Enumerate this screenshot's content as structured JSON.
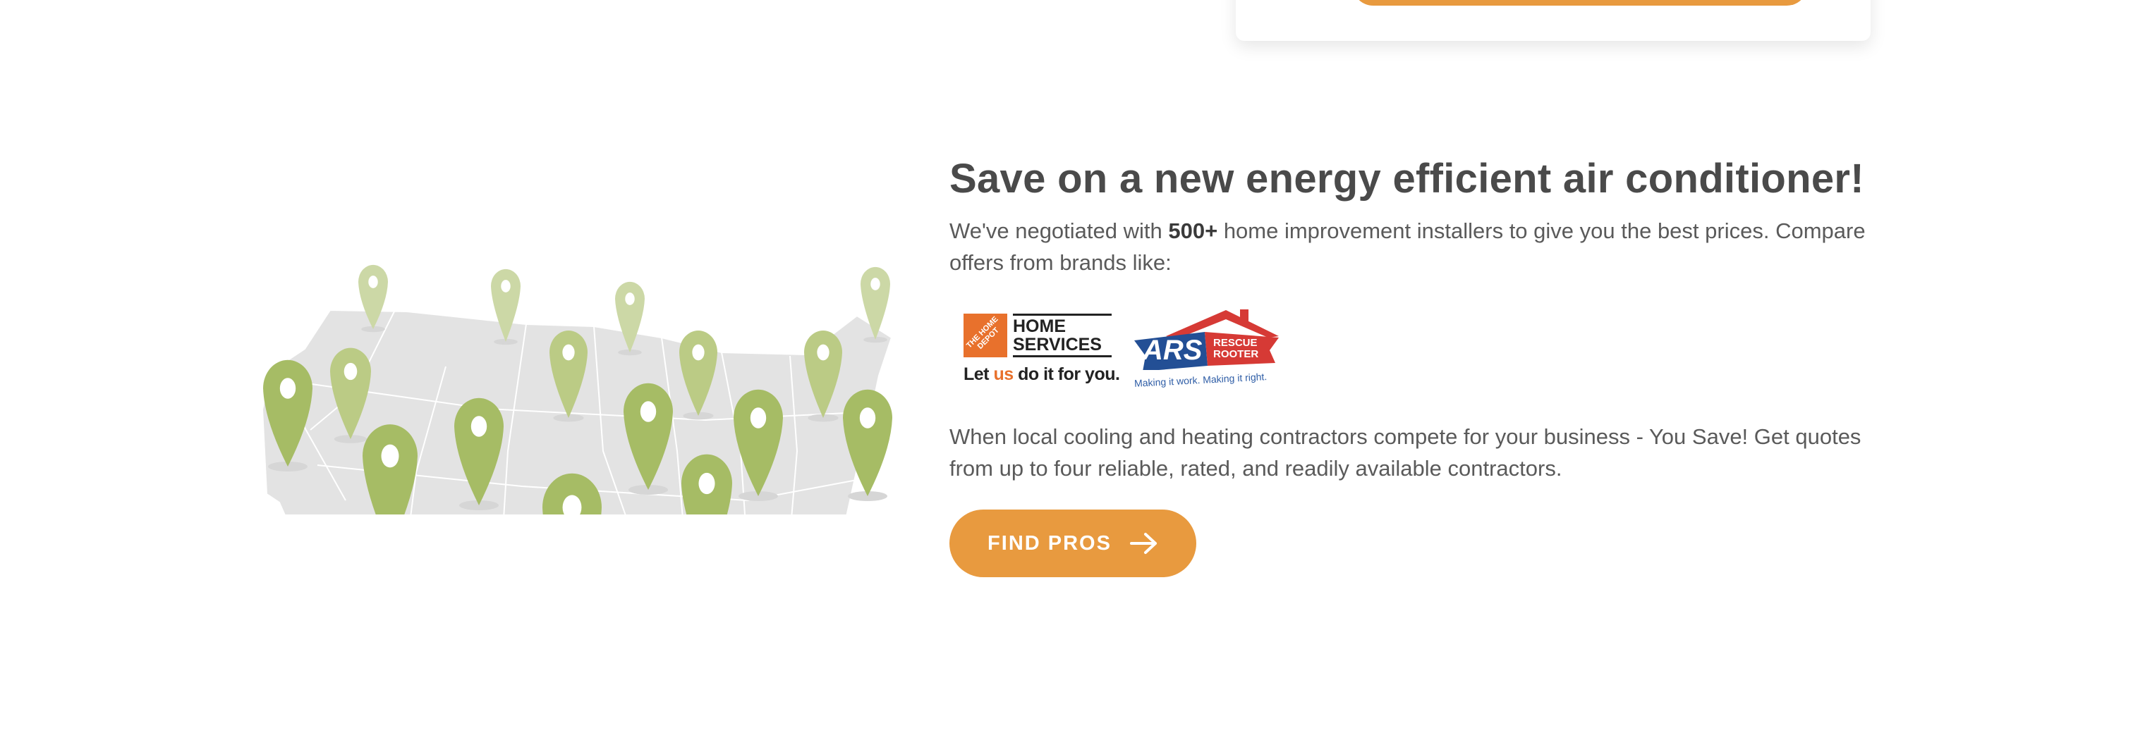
{
  "section": {
    "heading": "Save on a new energy efficient air conditioner!",
    "intro_before": "We've negotiated with ",
    "intro_bold": "500+",
    "intro_after": " home improvement installers to give you the best prices. Compare offers from brands like:",
    "compete_text": "When local cooling and heating contractors compete for your business - You Save! Get quotes from up to four reliable, rated, and readily available contractors.",
    "cta_label": "FIND PROS"
  },
  "logos": {
    "home_depot": {
      "badge": "THE HOME DEPOT",
      "line1": "HOME",
      "line2": "SERVICES",
      "tag_pre": "Let ",
      "tag_us": "us",
      "tag_post": " do it for you."
    },
    "ars": {
      "name": "ARS",
      "line1": "RESCUE",
      "line2": "ROOTER",
      "tagline": "Making it work. Making it right."
    }
  },
  "colors": {
    "accent": "#E89A3F",
    "pin_dark": "#A6BC65",
    "pin_mid": "#BBCB85",
    "pin_light": "#CCD8A6",
    "map": "#E3E3E3"
  }
}
